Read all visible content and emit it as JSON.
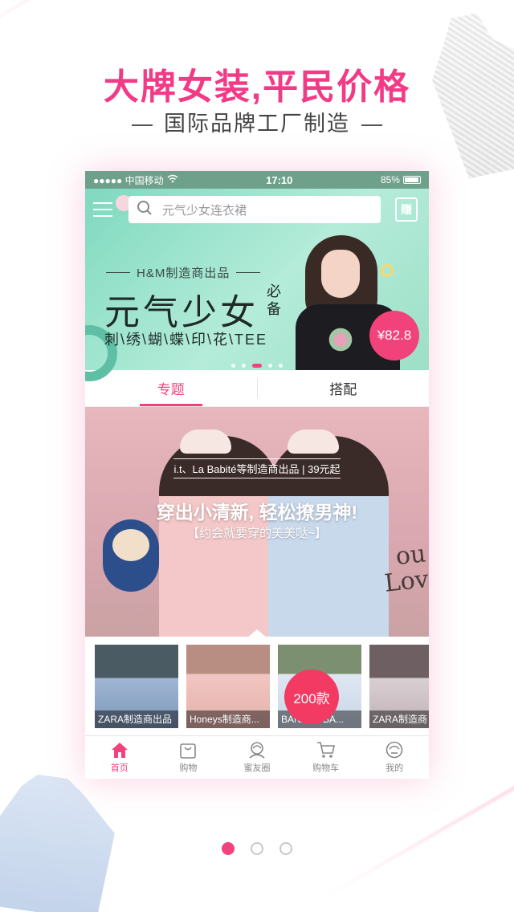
{
  "promo": {
    "headline": "大牌女装,平民价格",
    "subline": "国际品牌工厂制造"
  },
  "status_bar": {
    "carrier": "●●●●● 中国移动",
    "time": "17:10",
    "battery": "85%",
    "battery_level": 0.85
  },
  "search": {
    "placeholder": "元气少女连衣裙"
  },
  "header": {
    "earn_label": "赚"
  },
  "banner": {
    "tag": "H&M制造商出品",
    "title": "元气少女",
    "title_side": "必备",
    "subtitle": "刺\\绣\\蝴\\蝶\\印\\花\\TEE",
    "price": "¥82.8",
    "slide_count": 5,
    "active_slide": 3
  },
  "tabs": [
    {
      "label": "专题"
    },
    {
      "label": "搭配"
    }
  ],
  "feature": {
    "tag": "i.t、La Babité等制造商出品 | 39元起",
    "title": "穿出小清新, 轻松撩男神!",
    "subtitle": "【约会就要穿的美美哒~】",
    "wall_text": "ou\nLov"
  },
  "products": [
    {
      "caption": "ZARA制造商出品"
    },
    {
      "caption": "Honeys制造商..."
    },
    {
      "caption": "BANANA BA..."
    },
    {
      "caption": "ZARA制造商"
    }
  ],
  "count_badge": "200款",
  "tab_bar": [
    {
      "label": "首页",
      "icon": "home-icon"
    },
    {
      "label": "购物",
      "icon": "shopping-bag-icon"
    },
    {
      "label": "蜜友圈",
      "icon": "friends-icon"
    },
    {
      "label": "购物车",
      "icon": "cart-icon"
    },
    {
      "label": "我的",
      "icon": "profile-icon"
    }
  ],
  "pager": {
    "pages": 3,
    "active": 1
  },
  "colors": {
    "accent": "#f2427c",
    "headline": "#f23a86",
    "banner_bg": "#9ddfc7"
  }
}
